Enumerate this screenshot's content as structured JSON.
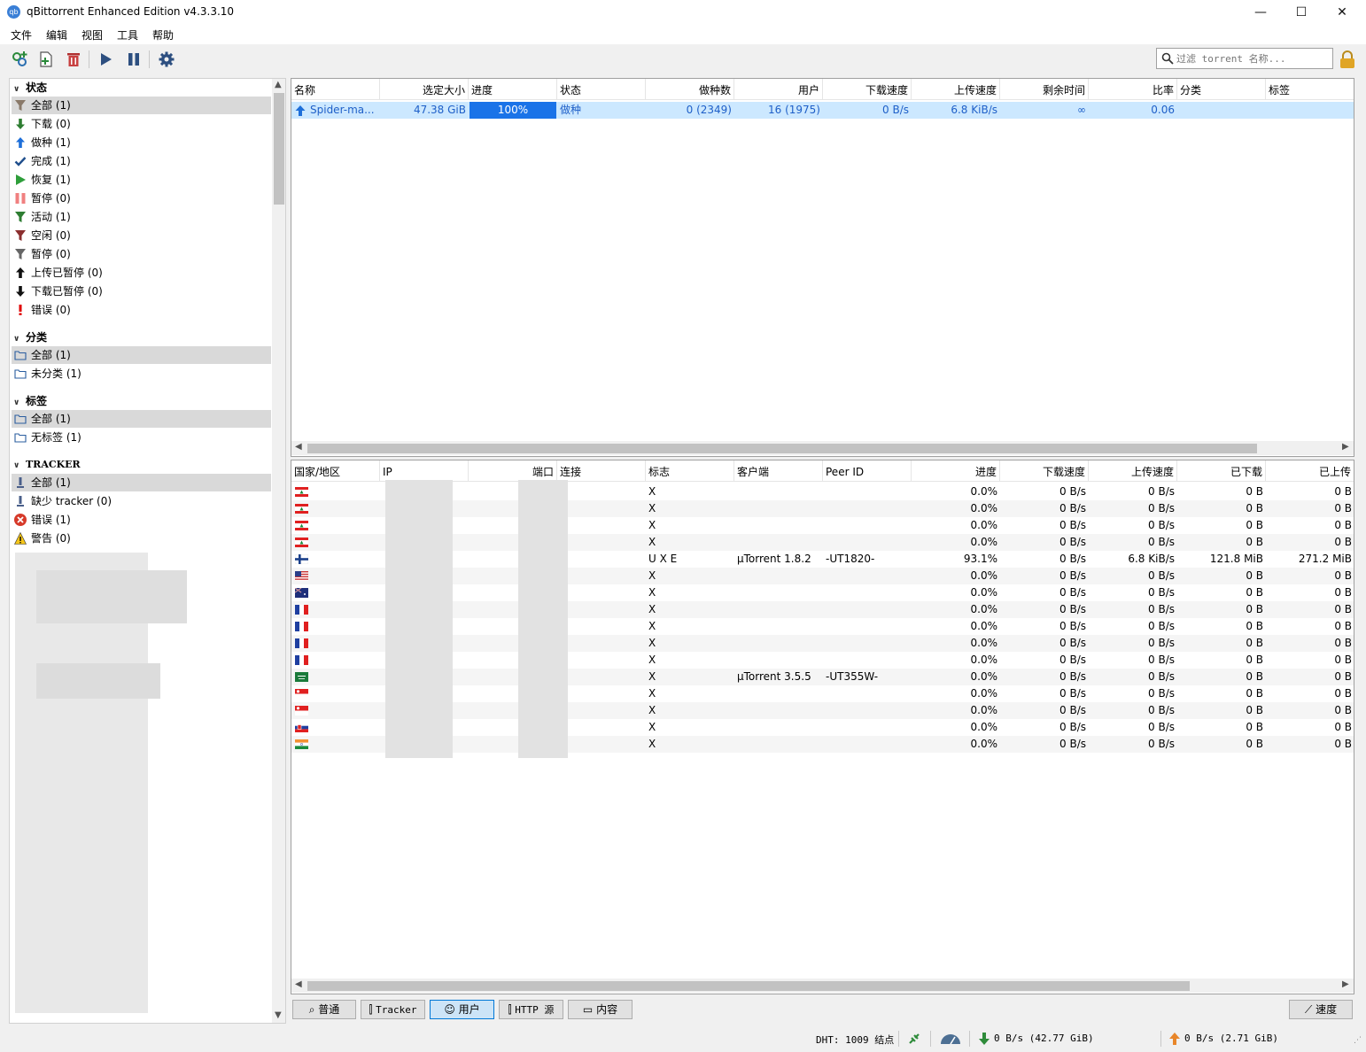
{
  "window": {
    "title": "qBittorrent Enhanced Edition v4.3.3.10",
    "app_icon_label": "qb",
    "minimize": "—",
    "maximize": "☐",
    "close": "✕"
  },
  "menu": [
    "文件",
    "编辑",
    "视图",
    "工具",
    "帮助"
  ],
  "toolbar": {
    "icons": [
      "add-link-icon",
      "add-torrent-icon",
      "delete-icon",
      "resume-icon",
      "pause-icon",
      "settings-icon"
    ],
    "search_placeholder": "过滤 torrent 名称..."
  },
  "sidebar": {
    "status_header": "状态",
    "status_items": [
      {
        "label": "全部 (1)",
        "icon": "filter-icon",
        "color": "#8a7a6a"
      },
      {
        "label": "下载 (0)",
        "icon": "arrow-down-icon",
        "color": "#2e7d32"
      },
      {
        "label": "做种 (1)",
        "icon": "arrow-up-icon",
        "color": "#1e6fd9"
      },
      {
        "label": "完成 (1)",
        "icon": "check-icon",
        "color": "#1f4e8c"
      },
      {
        "label": "恢复 (1)",
        "icon": "play-icon",
        "color": "#2e9e3a"
      },
      {
        "label": "暂停 (0)",
        "icon": "pause-icon",
        "color": "#f08080"
      },
      {
        "label": "活动 (1)",
        "icon": "filter-icon",
        "color": "#2e7d32"
      },
      {
        "label": "空闲 (0)",
        "icon": "filter-icon",
        "color": "#8b2f2f"
      },
      {
        "label": "暂停 (0)",
        "icon": "filter-icon",
        "color": "#666666"
      },
      {
        "label": "上传已暂停 (0)",
        "icon": "arrow-up-icon",
        "color": "#111111"
      },
      {
        "label": "下载已暂停 (0)",
        "icon": "arrow-down-icon",
        "color": "#111111"
      },
      {
        "label": "错误 (0)",
        "icon": "error-icon",
        "color": "#e00000"
      }
    ],
    "category_header": "分类",
    "category_items": [
      "全部 (1)",
      "未分类 (1)"
    ],
    "tag_header": "标签",
    "tag_items": [
      "全部 (1)",
      "无标签 (1)"
    ],
    "tracker_header": "TRACKER",
    "tracker_items": [
      {
        "label": "全部 (1)",
        "icon": "tracker-icon"
      },
      {
        "label": "缺少 tracker (0)",
        "icon": "tracker-icon"
      },
      {
        "label": "错误 (1)",
        "icon": "error-circle-icon"
      },
      {
        "label": "警告 (0)",
        "icon": "warning-icon"
      }
    ]
  },
  "torrents": {
    "headers": [
      "名称",
      "选定大小",
      "进度",
      "状态",
      "做种数",
      "用户",
      "下载速度",
      "上传速度",
      "剩余时间",
      "比率",
      "分类",
      "标签"
    ],
    "rows": [
      {
        "name": "Spider-ma...",
        "size": "47.38 GiB",
        "progress": 1.0,
        "progress_text": "100%",
        "status": "做种",
        "seeds": "0 (2349)",
        "peers": "16 (1975)",
        "dl": "0 B/s",
        "ul": "6.8 KiB/s",
        "eta": "∞",
        "ratio": "0.06",
        "category": "",
        "tags": ""
      }
    ]
  },
  "peers": {
    "headers": [
      "国家/地区",
      "IP",
      "端口",
      "连接",
      "标志",
      "客户端",
      "Peer ID",
      "进度",
      "下载速度",
      "上传速度",
      "已下载",
      "已上传"
    ],
    "rows": [
      {
        "flag": "lebanon",
        "flags": "X",
        "client": "",
        "peer_id": "",
        "progress": "0.0%",
        "dl": "0 B/s",
        "ul": "0 B/s",
        "downloaded": "0 B",
        "uploaded": "0 B"
      },
      {
        "flag": "lebanon",
        "flags": "X",
        "client": "",
        "peer_id": "",
        "progress": "0.0%",
        "dl": "0 B/s",
        "ul": "0 B/s",
        "downloaded": "0 B",
        "uploaded": "0 B"
      },
      {
        "flag": "lebanon",
        "flags": "X",
        "client": "",
        "peer_id": "",
        "progress": "0.0%",
        "dl": "0 B/s",
        "ul": "0 B/s",
        "downloaded": "0 B",
        "uploaded": "0 B"
      },
      {
        "flag": "lebanon",
        "flags": "X",
        "client": "",
        "peer_id": "",
        "progress": "0.0%",
        "dl": "0 B/s",
        "ul": "0 B/s",
        "downloaded": "0 B",
        "uploaded": "0 B"
      },
      {
        "flag": "finland",
        "flags": "U X E",
        "client": "µTorrent 1.8.2",
        "peer_id": "-UT1820-",
        "progress": "93.1%",
        "dl": "0 B/s",
        "ul": "6.8 KiB/s",
        "downloaded": "121.8 MiB",
        "uploaded": "271.2 MiB"
      },
      {
        "flag": "usa",
        "flags": "X",
        "client": "",
        "peer_id": "",
        "progress": "0.0%",
        "dl": "0 B/s",
        "ul": "0 B/s",
        "downloaded": "0 B",
        "uploaded": "0 B"
      },
      {
        "flag": "australia",
        "flags": "X",
        "client": "",
        "peer_id": "",
        "progress": "0.0%",
        "dl": "0 B/s",
        "ul": "0 B/s",
        "downloaded": "0 B",
        "uploaded": "0 B"
      },
      {
        "flag": "france",
        "flags": "X",
        "client": "",
        "peer_id": "",
        "progress": "0.0%",
        "dl": "0 B/s",
        "ul": "0 B/s",
        "downloaded": "0 B",
        "uploaded": "0 B"
      },
      {
        "flag": "france",
        "flags": "X",
        "client": "",
        "peer_id": "",
        "progress": "0.0%",
        "dl": "0 B/s",
        "ul": "0 B/s",
        "downloaded": "0 B",
        "uploaded": "0 B"
      },
      {
        "flag": "france",
        "flags": "X",
        "client": "",
        "peer_id": "",
        "progress": "0.0%",
        "dl": "0 B/s",
        "ul": "0 B/s",
        "downloaded": "0 B",
        "uploaded": "0 B"
      },
      {
        "flag": "france",
        "flags": "X",
        "client": "",
        "peer_id": "",
        "progress": "0.0%",
        "dl": "0 B/s",
        "ul": "0 B/s",
        "downloaded": "0 B",
        "uploaded": "0 B"
      },
      {
        "flag": "saudi",
        "flags": "X",
        "client": "µTorrent 3.5.5",
        "peer_id": "-UT355W-",
        "progress": "0.0%",
        "dl": "0 B/s",
        "ul": "0 B/s",
        "downloaded": "0 B",
        "uploaded": "0 B"
      },
      {
        "flag": "singapore",
        "flags": "X",
        "client": "",
        "peer_id": "",
        "progress": "0.0%",
        "dl": "0 B/s",
        "ul": "0 B/s",
        "downloaded": "0 B",
        "uploaded": "0 B"
      },
      {
        "flag": "singapore",
        "flags": "X",
        "client": "",
        "peer_id": "",
        "progress": "0.0%",
        "dl": "0 B/s",
        "ul": "0 B/s",
        "downloaded": "0 B",
        "uploaded": "0 B"
      },
      {
        "flag": "slovakia",
        "flags": "X",
        "client": "",
        "peer_id": "",
        "progress": "0.0%",
        "dl": "0 B/s",
        "ul": "0 B/s",
        "downloaded": "0 B",
        "uploaded": "0 B"
      },
      {
        "flag": "india",
        "flags": "X",
        "client": "",
        "peer_id": "",
        "progress": "0.0%",
        "dl": "0 B/s",
        "ul": "0 B/s",
        "downloaded": "0 B",
        "uploaded": "0 B"
      }
    ]
  },
  "tabs": {
    "general": "普通",
    "tracker": "Tracker",
    "peers": "用户",
    "http": "HTTP 源",
    "content": "内容",
    "speed": "速度"
  },
  "status": {
    "dht": "DHT: 1009 结点",
    "download": "0 B/s (42.77 GiB)",
    "upload": "0 B/s (2.71 GiB)"
  },
  "colors": {
    "accent": "#0078d7",
    "selection": "#cce8ff",
    "seeding_blue": "#1e5fc8"
  }
}
